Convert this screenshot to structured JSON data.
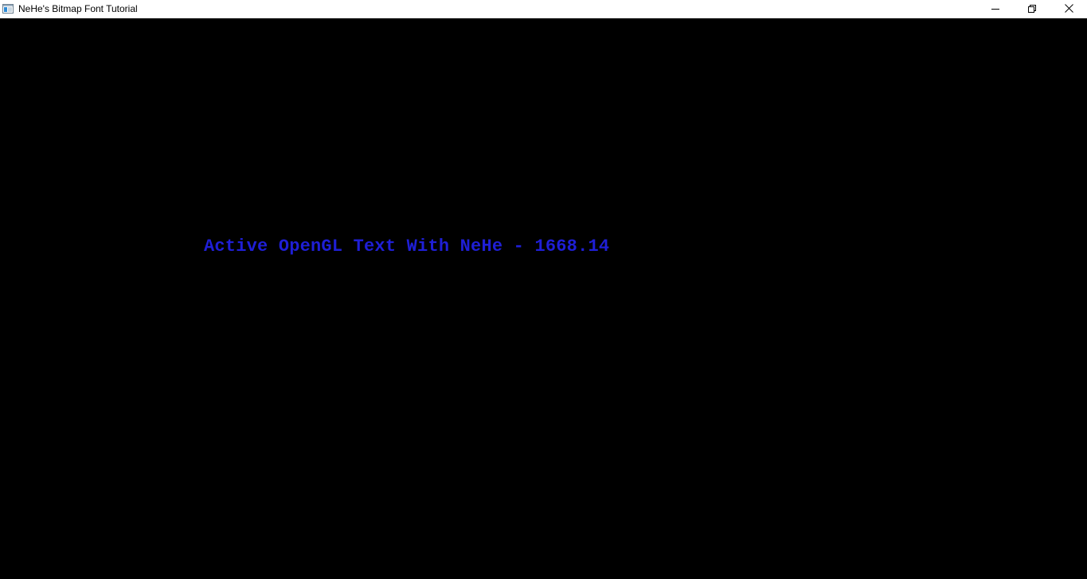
{
  "window": {
    "title": "NeHe's Bitmap Font Tutorial",
    "app_icon": "window-app-icon",
    "controls": {
      "minimize_icon": "minimize-icon",
      "maximize_icon": "restore-icon",
      "close_icon": "close-icon"
    }
  },
  "scene": {
    "background_color": "#000000",
    "text": "Active OpenGL Text With NeHe - 1668.14",
    "text_color": "#1f1fd6"
  }
}
